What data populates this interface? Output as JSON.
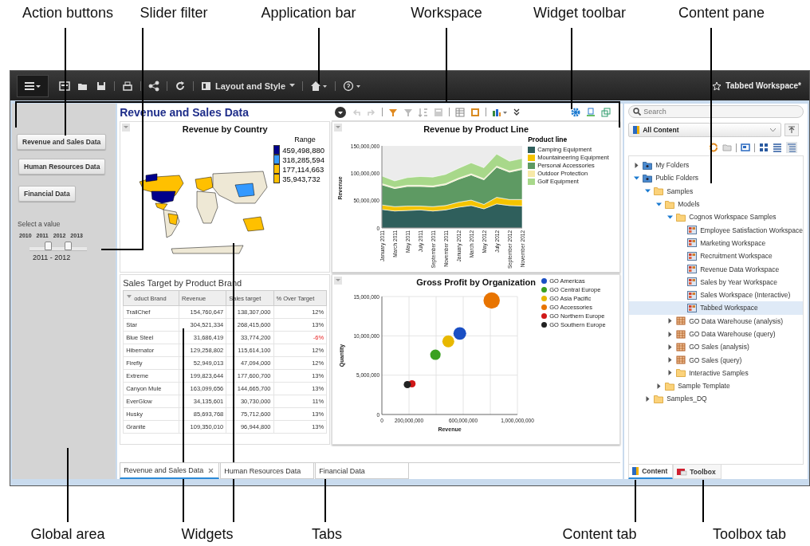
{
  "callouts_top": [
    {
      "label": "Action buttons"
    },
    {
      "label": "Slider filter"
    },
    {
      "label": "Application bar"
    },
    {
      "label": "Workspace"
    },
    {
      "label": "Widget toolbar"
    },
    {
      "label": "Content pane"
    }
  ],
  "callouts_bottom": [
    {
      "label": "Global area"
    },
    {
      "label": "Widgets"
    },
    {
      "label": "Tabs"
    },
    {
      "label": "Content tab"
    },
    {
      "label": "Toolbox tab"
    }
  ],
  "app_bar": {
    "layout_button": "Layout and Style",
    "workspace_title": "Tabbed Workspace*"
  },
  "global_area": {
    "action_buttons": [
      "Revenue and Sales Data",
      "Human Resources Data",
      "Financial Data"
    ],
    "slider": {
      "prompt": "Select a value",
      "ticks": [
        "2010",
        "2011",
        "2012",
        "2013"
      ],
      "thumbs": [
        {
          "level": 0.333
        },
        {
          "level": 0.667
        }
      ],
      "reading": "2011 - 2012"
    }
  },
  "workspace": {
    "title": "Revenue and Sales Data",
    "map_widget": {
      "title": "Revenue by Country",
      "legend_title": "Range",
      "legend": [
        {
          "value": "459,498,880",
          "color": "#00008b"
        },
        {
          "value": "318,285,594",
          "color": "#3399ff"
        },
        {
          "value": "177,114,663",
          "color": "#ffc000"
        },
        {
          "value": "35,943,732",
          "color": "#ffc000"
        }
      ]
    },
    "area_widget": {
      "legend_title": "Product line",
      "chart_data": {
        "type": "area",
        "title": "Revenue by Product Line",
        "ylabel": "Revenue",
        "stacked": true,
        "categories": [
          "January 2011",
          "March 2011",
          "May 2011",
          "July 2011",
          "September 2011",
          "November 2011",
          "January 2012",
          "March 2012",
          "May 2012",
          "July 2012",
          "September 2012",
          "November 2012"
        ],
        "ylim": [
          0,
          150000000
        ],
        "yticks": [
          {
            "value": 0,
            "label": "0"
          },
          {
            "value": 50000000,
            "label": "50,000,000"
          },
          {
            "value": 100000000,
            "label": "100,000,000"
          },
          {
            "value": 150000000,
            "label": "150,000,000"
          }
        ],
        "series": [
          {
            "name": "Camping Equipment",
            "color": "#2f5f5c",
            "values": [
              34000000,
              31000000,
              32000000,
              33000000,
              31000000,
              33000000,
              38000000,
              41000000,
              35000000,
              44000000,
              41000000,
              40000000
            ]
          },
          {
            "name": "Mountaineering Equipment",
            "color": "#f5c400",
            "values": [
              8000000,
              8000000,
              8000000,
              7000000,
              8000000,
              8000000,
              9000000,
              10000000,
              8000000,
              12000000,
              11000000,
              12000000
            ]
          },
          {
            "name": "Personal Accessories",
            "color": "#5e9a63",
            "values": [
              37000000,
              33000000,
              36000000,
              36000000,
              36000000,
              38000000,
              42000000,
              46000000,
              45000000,
              55000000,
              50000000,
              55000000
            ]
          },
          {
            "name": "Outdoor Protection",
            "color": "#f7e9a8",
            "values": [
              2000000,
              2000000,
              2000000,
              2000000,
              2000000,
              2000000,
              2000000,
              2000000,
              2000000,
              2000000,
              2000000,
              2000000
            ]
          },
          {
            "name": "Golf Equipment",
            "color": "#a8d88a",
            "values": [
              14000000,
              12000000,
              14000000,
              16000000,
              16000000,
              17000000,
              18000000,
              20000000,
              20000000,
              22000000,
              18000000,
              18000000
            ]
          }
        ]
      }
    },
    "table_widget": {
      "title": "Sales Target by Product Brand",
      "columns": [
        "oduct Brand",
        "Revenue",
        "Sales target",
        "% Over Target"
      ],
      "rows": [
        {
          "cells": [
            "TrailChef",
            "154,760,647",
            "138,307,000",
            "12%"
          ],
          "below_target": false
        },
        {
          "cells": [
            "Star",
            "304,521,334",
            "268,415,600",
            "13%"
          ],
          "below_target": false
        },
        {
          "cells": [
            "Blue Steel",
            "31,686,419",
            "33,774,200",
            "-6%"
          ],
          "below_target": true
        },
        {
          "cells": [
            "Hibernator",
            "129,258,802",
            "115,614,100",
            "12%"
          ],
          "below_target": false
        },
        {
          "cells": [
            "Firefly",
            "52,949,013",
            "47,094,000",
            "12%"
          ],
          "below_target": false
        },
        {
          "cells": [
            "Extreme",
            "199,823,644",
            "177,600,700",
            "13%"
          ],
          "below_target": false
        },
        {
          "cells": [
            "Canyon Mule",
            "163,099,656",
            "144,665,700",
            "13%"
          ],
          "below_target": false
        },
        {
          "cells": [
            "EverGlow",
            "34,135,601",
            "30,730,000",
            "11%"
          ],
          "below_target": false
        },
        {
          "cells": [
            "Husky",
            "85,693,768",
            "75,712,600",
            "13%"
          ],
          "below_target": false
        },
        {
          "cells": [
            "Granite",
            "109,350,010",
            "96,944,800",
            "13%"
          ],
          "below_target": false
        }
      ]
    },
    "bubble_widget": {
      "chart_data": {
        "type": "scatter",
        "title": "Gross Profit by Organization",
        "xlabel": "Revenue",
        "ylabel": "Quantity",
        "xlim": [
          0,
          1000000000
        ],
        "ylim": [
          0,
          15000000
        ],
        "x": [
          575000000,
          395000000,
          490000000,
          810000000,
          222000000,
          188000000
        ],
        "grid": true,
        "xticks": [
          {
            "value": 0,
            "label": "0"
          },
          {
            "value": 200000000,
            "label": "200,000,000"
          },
          {
            "value": 600000000,
            "label": "600,000,000"
          },
          {
            "value": 1000000000,
            "label": "1,000,000,000"
          }
        ],
        "yticks": [
          {
            "value": 0,
            "label": "0"
          },
          {
            "value": 5000000,
            "label": "5,000,000"
          },
          {
            "value": 10000000,
            "label": "10,000,000"
          },
          {
            "value": 15000000,
            "label": "15,000,000"
          }
        ],
        "series": [
          {
            "name": "GO Americas",
            "color": "#1a4fc4",
            "values": [
              10300000,
              null,
              null,
              null,
              null,
              null
            ]
          },
          {
            "name": "GO Central Europe",
            "color": "#3aa020",
            "values": [
              null,
              7600000,
              null,
              null,
              null,
              null
            ]
          },
          {
            "name": "GO Asia Pacific",
            "color": "#e8b800",
            "values": [
              null,
              null,
              9300000,
              null,
              null,
              null
            ]
          },
          {
            "name": "GO Accessories",
            "color": "#e87400",
            "values": [
              null,
              null,
              null,
              14500000,
              null,
              null
            ]
          },
          {
            "name": "GO Northern Europe",
            "color": "#d01818",
            "values": [
              null,
              null,
              null,
              null,
              3900000,
              null
            ]
          },
          {
            "name": "GO Southern Europe",
            "color": "#222222",
            "values": [
              null,
              null,
              null,
              null,
              null,
              3800000
            ]
          }
        ]
      }
    },
    "tabs": [
      {
        "label": "Revenue and Sales Data",
        "selected": true
      },
      {
        "label": "Human Resources Data",
        "selected": false
      },
      {
        "label": "Financial Data",
        "selected": false
      }
    ]
  },
  "content_pane": {
    "search_placeholder": "Search",
    "source": "All Content",
    "tree": [
      {
        "label": "My Folders",
        "kind": "server",
        "expanded": false,
        "selected": false
      },
      {
        "label": "Public Folders",
        "kind": "server",
        "expanded": true,
        "selected": false,
        "children": [
          {
            "label": "Samples",
            "kind": "folder",
            "expanded": true,
            "selected": false,
            "children": [
              {
                "label": "Models",
                "kind": "folder",
                "expanded": true,
                "selected": false,
                "children": [
                  {
                    "label": "Cognos Workspace Samples",
                    "kind": "folder",
                    "expanded": true,
                    "selected": false,
                    "children": [
                      {
                        "label": "Employee Satisfaction Workspace",
                        "kind": "workspace",
                        "selected": false
                      },
                      {
                        "label": "Marketing Workspace",
                        "kind": "workspace",
                        "selected": false
                      },
                      {
                        "label": "Recruitment Workspace",
                        "kind": "workspace",
                        "selected": false
                      },
                      {
                        "label": "Revenue Data Workspace",
                        "kind": "workspace",
                        "selected": false
                      },
                      {
                        "label": "Sales by Year Workspace",
                        "kind": "workspace",
                        "selected": false
                      },
                      {
                        "label": "Sales Workspace (Interactive)",
                        "kind": "workspace",
                        "selected": false
                      },
                      {
                        "label": "Tabbed Workspace",
                        "kind": "workspace",
                        "selected": true
                      }
                    ]
                  },
                  {
                    "label": "GO Data Warehouse (analysis)",
                    "kind": "package",
                    "expanded": false,
                    "selected": false
                  },
                  {
                    "label": "GO Data Warehouse (query)",
                    "kind": "package",
                    "expanded": false,
                    "selected": false
                  },
                  {
                    "label": "GO Sales (analysis)",
                    "kind": "package",
                    "expanded": false,
                    "selected": false
                  },
                  {
                    "label": "GO Sales (query)",
                    "kind": "package",
                    "expanded": false,
                    "selected": false
                  },
                  {
                    "label": "Interactive Samples",
                    "kind": "folder",
                    "expanded": false,
                    "selected": false
                  }
                ]
              },
              {
                "label": "Sample Template",
                "kind": "folder",
                "expanded": false,
                "selected": false
              }
            ]
          },
          {
            "label": "Samples_DQ",
            "kind": "folder",
            "expanded": false,
            "selected": false
          }
        ]
      }
    ],
    "tabs": [
      {
        "label": "Content",
        "selected": true
      },
      {
        "label": "Toolbox",
        "selected": false
      }
    ]
  }
}
